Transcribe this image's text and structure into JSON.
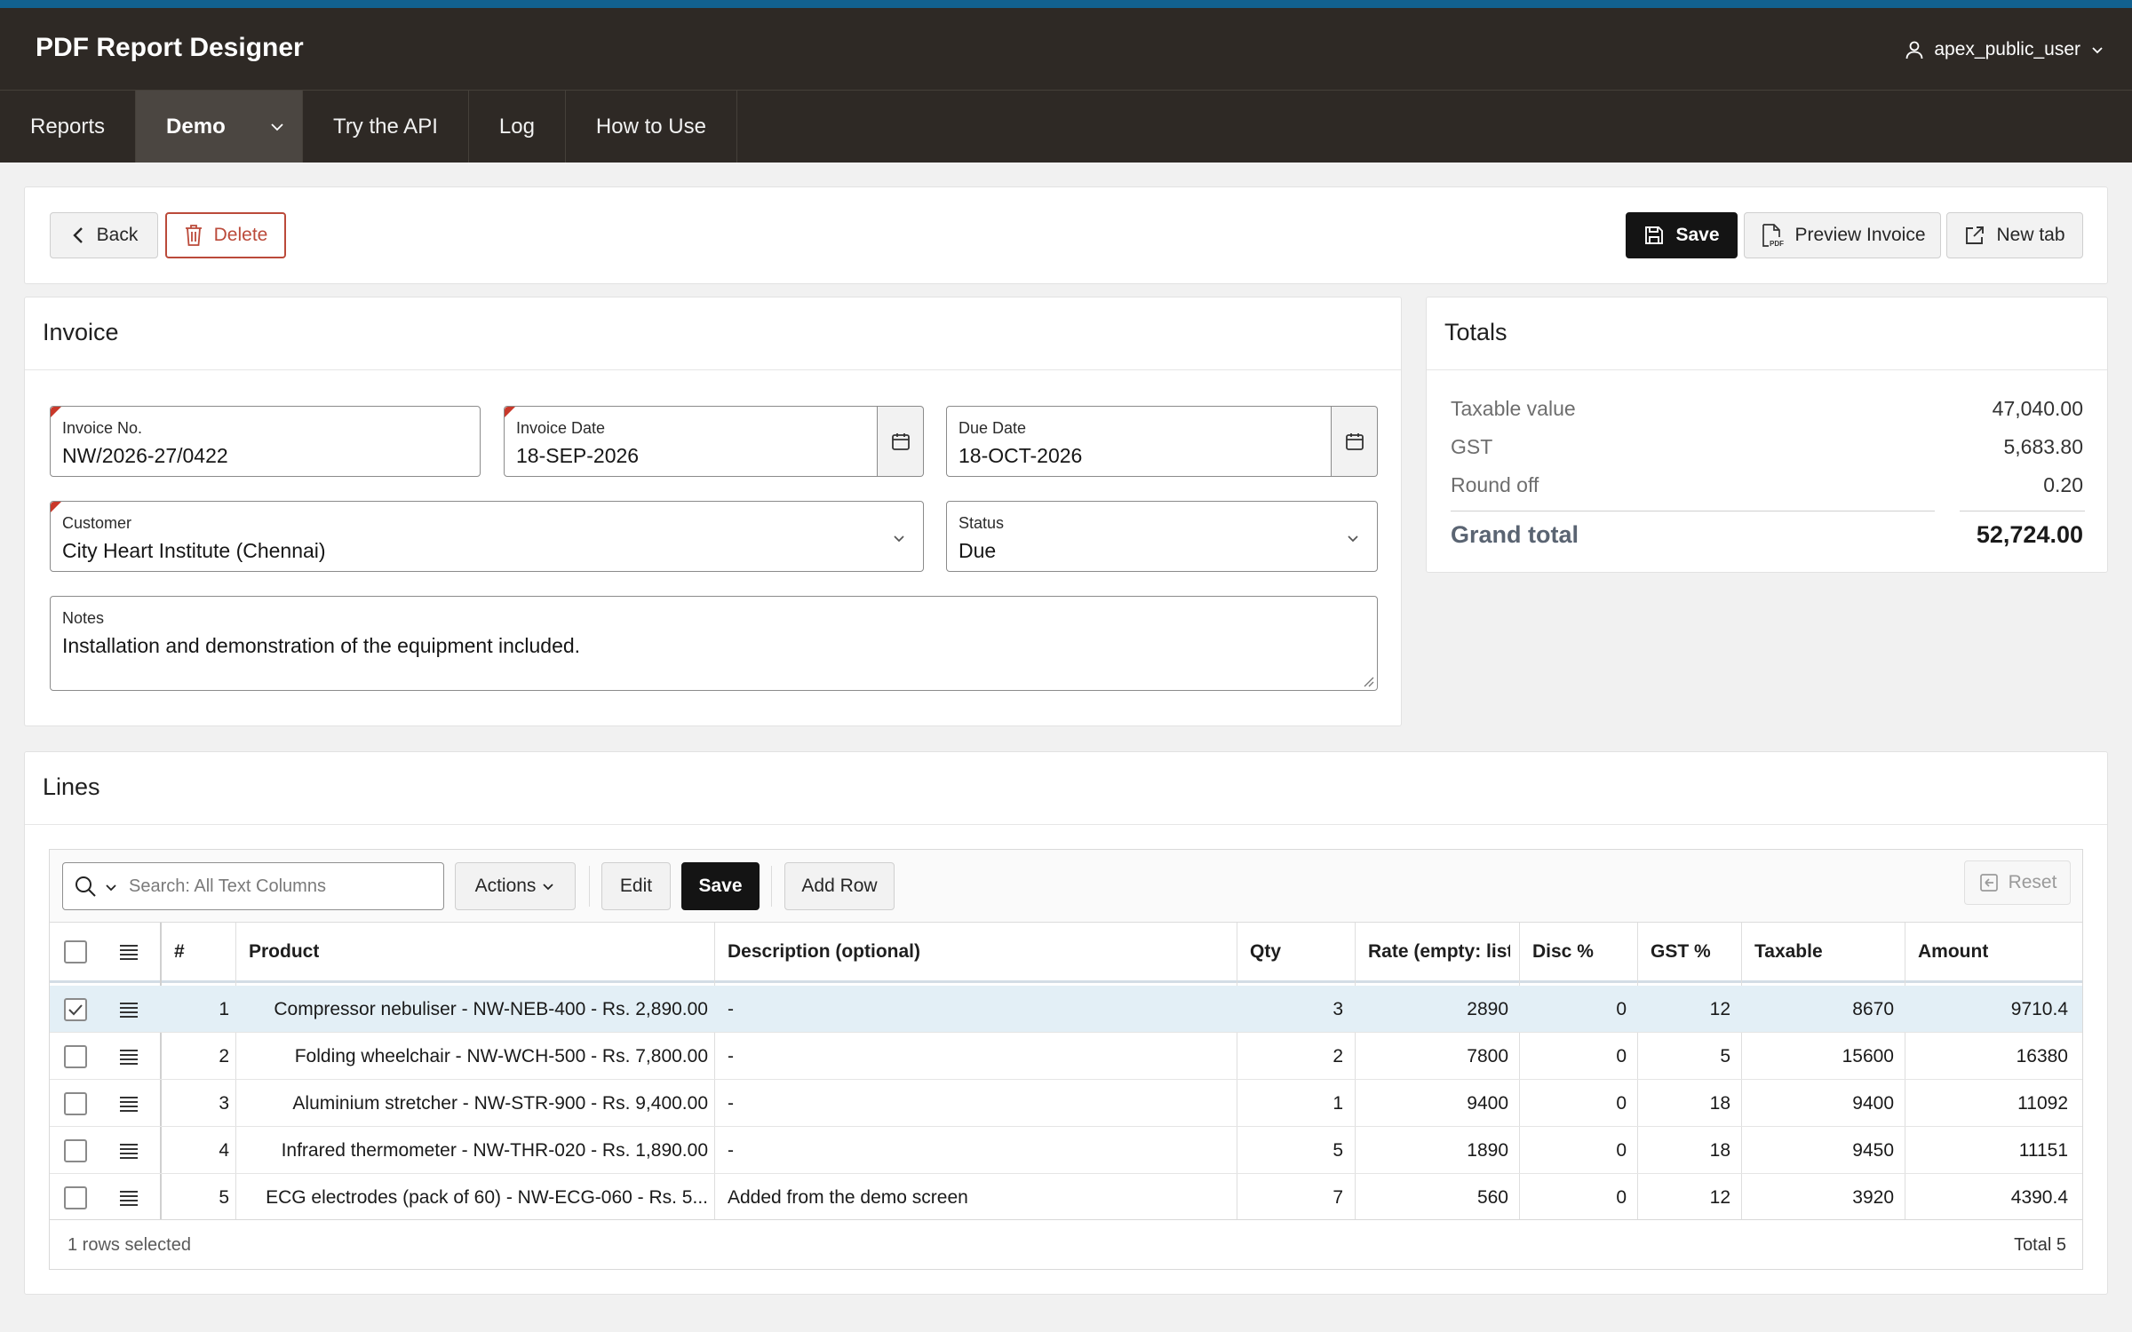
{
  "app": {
    "title": "PDF Report Designer",
    "user": "apex_public_user"
  },
  "nav": [
    {
      "label": "Reports"
    },
    {
      "label": "Demo"
    },
    {
      "label": "Try the API"
    },
    {
      "label": "Log"
    },
    {
      "label": "How to Use"
    }
  ],
  "toolbar": {
    "back": "Back",
    "delete": "Delete",
    "save": "Save",
    "preview": "Preview Invoice",
    "new_tab": "New tab"
  },
  "invoice": {
    "title": "Invoice",
    "invoice_no": {
      "label": "Invoice No.",
      "value": "NW/2026-27/0422"
    },
    "invoice_date": {
      "label": "Invoice Date",
      "value": "18-SEP-2026"
    },
    "due_date": {
      "label": "Due Date",
      "value": "18-OCT-2026"
    },
    "customer": {
      "label": "Customer",
      "value": "City Heart Institute (Chennai)"
    },
    "status": {
      "label": "Status",
      "value": "Due"
    },
    "notes": {
      "label": "Notes",
      "value": "Installation and demonstration of the equipment included."
    }
  },
  "totals": {
    "title": "Totals",
    "rows": [
      {
        "label": "Taxable value",
        "value": "47,040.00"
      },
      {
        "label": "GST",
        "value": "5,683.80"
      },
      {
        "label": "Round off",
        "value": "0.20"
      }
    ],
    "grand": {
      "label": "Grand total",
      "value": "52,724.00"
    }
  },
  "lines": {
    "title": "Lines",
    "search_placeholder": "Search: All Text Columns",
    "actions": "Actions",
    "edit": "Edit",
    "save": "Save",
    "add_row": "Add Row",
    "reset": "Reset",
    "columns": [
      "#",
      "Product",
      "Description (optional)",
      "Qty",
      "Rate (empty: list",
      "Disc %",
      "GST %",
      "Taxable",
      "Amount"
    ],
    "rows": [
      {
        "selected": true,
        "cells": [
          "1",
          "Compressor nebuliser - NW-NEB-400 - Rs. 2,890.00",
          "-",
          "3",
          "2890",
          "0",
          "12",
          "8670",
          "9710.4"
        ]
      },
      {
        "selected": false,
        "cells": [
          "2",
          "Folding wheelchair - NW-WCH-500 - Rs. 7,800.00",
          "-",
          "2",
          "7800",
          "0",
          "5",
          "15600",
          "16380"
        ]
      },
      {
        "selected": false,
        "cells": [
          "3",
          "Aluminium stretcher - NW-STR-900 - Rs. 9,400.00",
          "-",
          "1",
          "9400",
          "0",
          "18",
          "9400",
          "11092"
        ]
      },
      {
        "selected": false,
        "cells": [
          "4",
          "Infrared thermometer - NW-THR-020 - Rs. 1,890.00",
          "-",
          "5",
          "1890",
          "0",
          "18",
          "9450",
          "11151"
        ]
      },
      {
        "selected": false,
        "cells": [
          "5",
          "ECG electrodes (pack of 60) - NW-ECG-060 - Rs. 5...",
          "Added from the demo screen",
          "7",
          "560",
          "0",
          "12",
          "3920",
          "4390.4"
        ]
      }
    ],
    "footer_selected": "1 rows selected",
    "footer_total": "Total 5"
  }
}
